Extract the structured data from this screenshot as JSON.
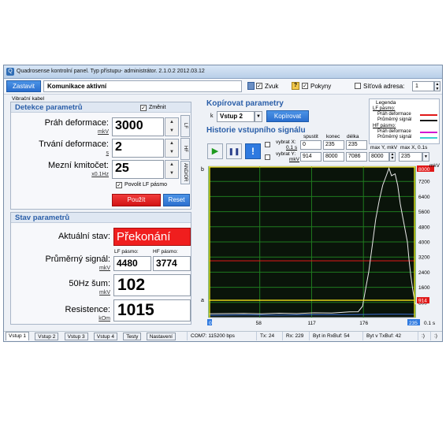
{
  "window": {
    "title": "Quadrosense kontrolní panel. Typ přístupu- administrátor. 2.1.0.2 2012.03.12",
    "app_icon": "Q"
  },
  "toolbar": {
    "stop_label": "Zastavit",
    "status_text": "Komunikace aktivní",
    "sound_label": "Zvuk",
    "sound_checked": "✓",
    "instructions_label": "Pokyny",
    "instructions_checked": "✓",
    "instructions_icon": "?",
    "network_address_label": "Síťová adresa:",
    "network_address_value": "1"
  },
  "tab_caption": "Vibrační kabel",
  "detection": {
    "title": "Detekce parametrů",
    "change_label": "Změnit",
    "change_checked": "✓",
    "threshold_label": "Práh deformace:",
    "threshold_unit": "mkV",
    "threshold_value": "3000",
    "duration_label": "Trvání deformace:",
    "duration_unit": "s",
    "duration_value": "2",
    "cutoff_label": "Mezní kmitočet:",
    "cutoff_unit": "x0.1Hz",
    "cutoff_value": "25",
    "tab_lf": "LF",
    "tab_hf": "HF",
    "tab_andor": "AND/OR",
    "allow_lf_label": "Povolit LF pásmo",
    "allow_lf_checked": "✓",
    "apply_label": "Použít",
    "reset_label": "Reset"
  },
  "state": {
    "title": "Stav parametrů",
    "current_label": "Aktuální stav:",
    "current_value": "Překonání",
    "avg_signal_label": "Průměrný signál:",
    "avg_signal_unit": "mkV",
    "lf_band_label": "LF pásmo:",
    "hf_band_label": "HF pásmo:",
    "lf_value": "4480",
    "hf_value": "3774",
    "noise_label": "50Hz šum:",
    "noise_unit": "mkV",
    "noise_value": "102",
    "resistance_label": "Resistence:",
    "resistance_unit": "kOm",
    "resistance_value": "1015"
  },
  "copy": {
    "title": "Kopírovat parametry",
    "prefix": "k",
    "select_value": "Vstup 2",
    "button_label": "Kopírovat"
  },
  "legend": {
    "title": "Legenda",
    "lf_band": "LF pásmo:",
    "lf_threshold": "Práh deformace",
    "lf_avg": "Průměrný signál",
    "hf_band": "HF pásmo:",
    "hf_threshold": "Práh deformace",
    "hf_avg": "Průměrný signál",
    "colors": {
      "lf_threshold": "#e01818",
      "lf_avg": "#1a1a1a",
      "hf_threshold": "#d21ad2",
      "hf_avg": "#3ad0d0"
    }
  },
  "history": {
    "title": "Historie vstupního signálu",
    "play_icon": "▶",
    "pause_icon": "❚❚",
    "alert_icon": "!",
    "select_x_label": "vybrat X:",
    "select_x_unit": "0.1 s",
    "select_y_label": "vybrat Y:",
    "select_y_unit": "mkV",
    "start_label": "spustit",
    "end_label": "konec",
    "length_label": "délka",
    "x_start": "0",
    "x_end": "235",
    "x_length": "235",
    "y_start": "914",
    "y_end": "8000",
    "y_length": "7086",
    "max_y_label": "max Y, mkV",
    "max_y_value": "8000",
    "max_x_label": "max X, 0.1s",
    "max_x_value": "235"
  },
  "chart_data": {
    "type": "line",
    "xlabel": "0.1 s",
    "ylabel": "mkV",
    "xlim": [
      0,
      235
    ],
    "ylim": [
      0,
      8000
    ],
    "x_ticks": [
      "0",
      "58",
      "117",
      "176",
      "235"
    ],
    "y_ticks": [
      "7200",
      "6400",
      "5600",
      "4800",
      "4000",
      "3200",
      "2400",
      "1600",
      "800"
    ],
    "y_top_label": "8000",
    "y_marker_label": "914",
    "x_marker_label": "235",
    "marker_b": "b",
    "marker_a": "a",
    "threshold": 3000,
    "cursor_y": 914,
    "series": [
      {
        "color": "#e8e8e8",
        "x": [
          0,
          20,
          40,
          60,
          80,
          100,
          120,
          140,
          160,
          170,
          175,
          178,
          182,
          186,
          190,
          194,
          198,
          202,
          205,
          208,
          212,
          215,
          218,
          222,
          226,
          228,
          230,
          232,
          235
        ],
        "values": [
          200,
          210,
          220,
          200,
          230,
          210,
          250,
          240,
          300,
          310,
          600,
          1400,
          2400,
          3800,
          5200,
          6200,
          7000,
          7500,
          7900,
          7500,
          7600,
          7000,
          6000,
          5000,
          4000,
          3000,
          2200,
          1500,
          700
        ]
      },
      {
        "color": "#3a6fd8",
        "x": [
          0,
          40,
          80,
          120,
          160,
          200,
          235
        ],
        "values": [
          120,
          140,
          130,
          150,
          160,
          180,
          170
        ]
      }
    ]
  },
  "statusbar": {
    "tabs": [
      "Vstup 1",
      "Vstup 2",
      "Vstup 3",
      "Vstup 4",
      "Testy",
      "Nastavení"
    ],
    "com": "COM7: 115200 bps",
    "tx": "Tx: 24",
    "rx": "Rx: 229",
    "rxbuf": "Byt in RxBuf: 54",
    "txbuf": "Byt v TxBuf: 42",
    "colon1": ":)",
    "colon2": ":)"
  }
}
